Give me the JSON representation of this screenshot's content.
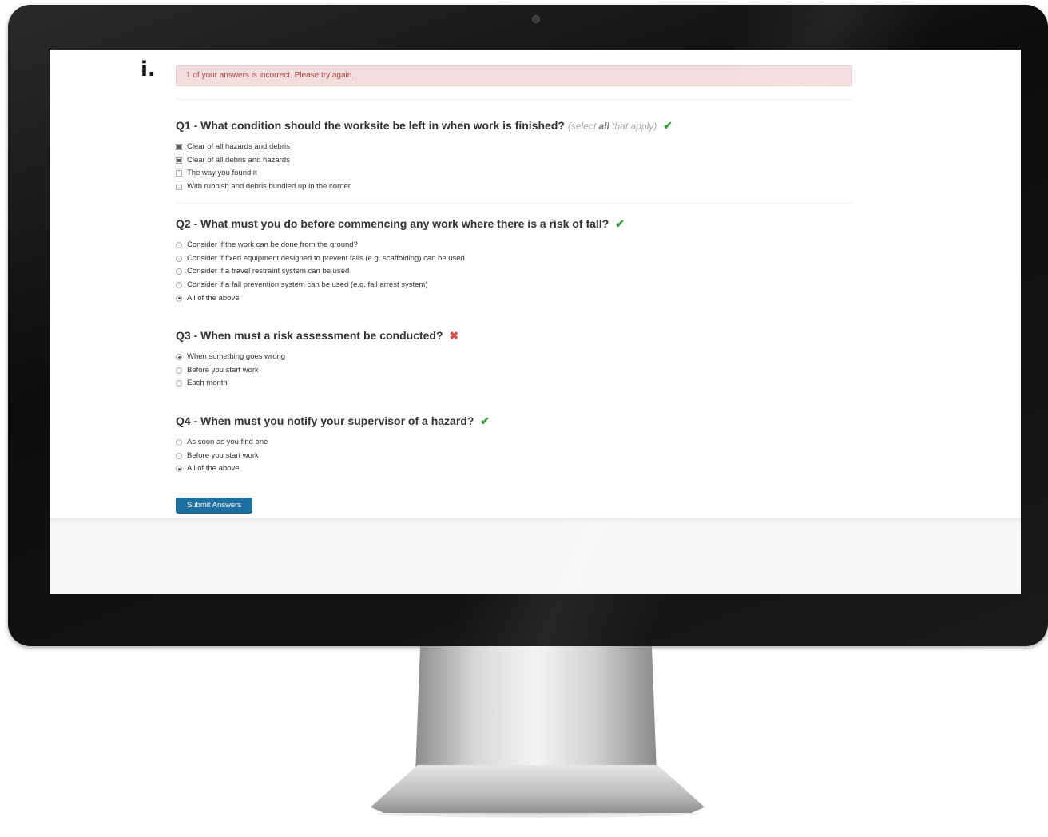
{
  "figure_label": "i.",
  "alert": {
    "text": "1 of your answers is incorrect. Please try again."
  },
  "questions": [
    {
      "title": "Q1 - What condition should the worksite be left in when work is finished?",
      "hint_prefix": "(select ",
      "hint_bold": "all",
      "hint_suffix": " that apply)",
      "result": "correct",
      "result_symbol": "✔",
      "input_type": "checkbox",
      "options": [
        {
          "label": "Clear of all hazards and debris",
          "checked": true
        },
        {
          "label": "Clear of all debris and hazards",
          "checked": true
        },
        {
          "label": "The way you found it",
          "checked": false
        },
        {
          "label": "With rubbish and debris bundled up in the corner",
          "checked": false
        }
      ]
    },
    {
      "title": "Q2 - What must you do before commencing any work where there is a risk of fall?",
      "result": "correct",
      "result_symbol": "✔",
      "input_type": "radio",
      "options": [
        {
          "label": "Consider if the work can be done from the ground?",
          "checked": false
        },
        {
          "label": "Consider if fixed equipment designed to prevent falls (e.g. scaffolding) can be used",
          "checked": false
        },
        {
          "label": "Consider if a travel restraint system can be used",
          "checked": false
        },
        {
          "label": "Consider if a fall prevention system can be used (e.g. fall arrest system)",
          "checked": false
        },
        {
          "label": "All of the above",
          "checked": true
        }
      ]
    },
    {
      "title": "Q3 - When must a risk assessment be conducted?",
      "result": "incorrect",
      "result_symbol": "✖",
      "input_type": "radio",
      "options": [
        {
          "label": "When something goes wrong",
          "checked": true
        },
        {
          "label": "Before you start work",
          "checked": false
        },
        {
          "label": "Each month",
          "checked": false
        }
      ]
    },
    {
      "title": "Q4 - When must you notify your supervisor of a hazard?",
      "result": "correct",
      "result_symbol": "✔",
      "input_type": "radio",
      "options": [
        {
          "label": "As soon as you find one",
          "checked": false
        },
        {
          "label": "Before you start work",
          "checked": false
        },
        {
          "label": "All of the above",
          "checked": true
        }
      ]
    }
  ],
  "submit_label": "Submit Answers",
  "colors": {
    "alert_bg": "#f2dede",
    "alert_text": "#a94442",
    "correct": "#3c9a3c",
    "incorrect": "#d9534f",
    "submit_bg": "#1f6f9f"
  }
}
